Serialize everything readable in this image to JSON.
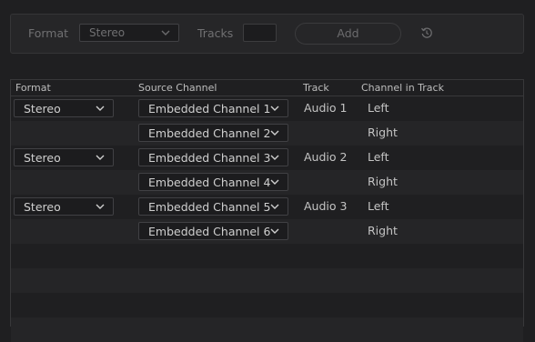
{
  "toolbar": {
    "format_label": "Format",
    "format_value": "Stereo",
    "tracks_label": "Tracks",
    "tracks_value": "",
    "add_label": "Add"
  },
  "table": {
    "columns": [
      "Format",
      "Source Channel",
      "Track",
      "Channel in Track"
    ],
    "rows": [
      {
        "format": "Stereo",
        "source": "Embedded Channel 1",
        "track": "Audio 1",
        "channel": "Left"
      },
      {
        "format": "",
        "source": "Embedded Channel 2",
        "track": "",
        "channel": "Right"
      },
      {
        "format": "Stereo",
        "source": "Embedded Channel 3",
        "track": "Audio 2",
        "channel": "Left"
      },
      {
        "format": "",
        "source": "Embedded Channel 4",
        "track": "",
        "channel": "Right"
      },
      {
        "format": "Stereo",
        "source": "Embedded Channel 5",
        "track": "Audio 3",
        "channel": "Left"
      },
      {
        "format": "",
        "source": "Embedded Channel 6",
        "track": "",
        "channel": "Right"
      }
    ]
  },
  "icons": {
    "dropdown": "chevron-down-icon",
    "reset": "reset-icon"
  },
  "colors": {
    "background": "#1f1f21",
    "panel": "#262628",
    "alt_row": "#252527"
  }
}
